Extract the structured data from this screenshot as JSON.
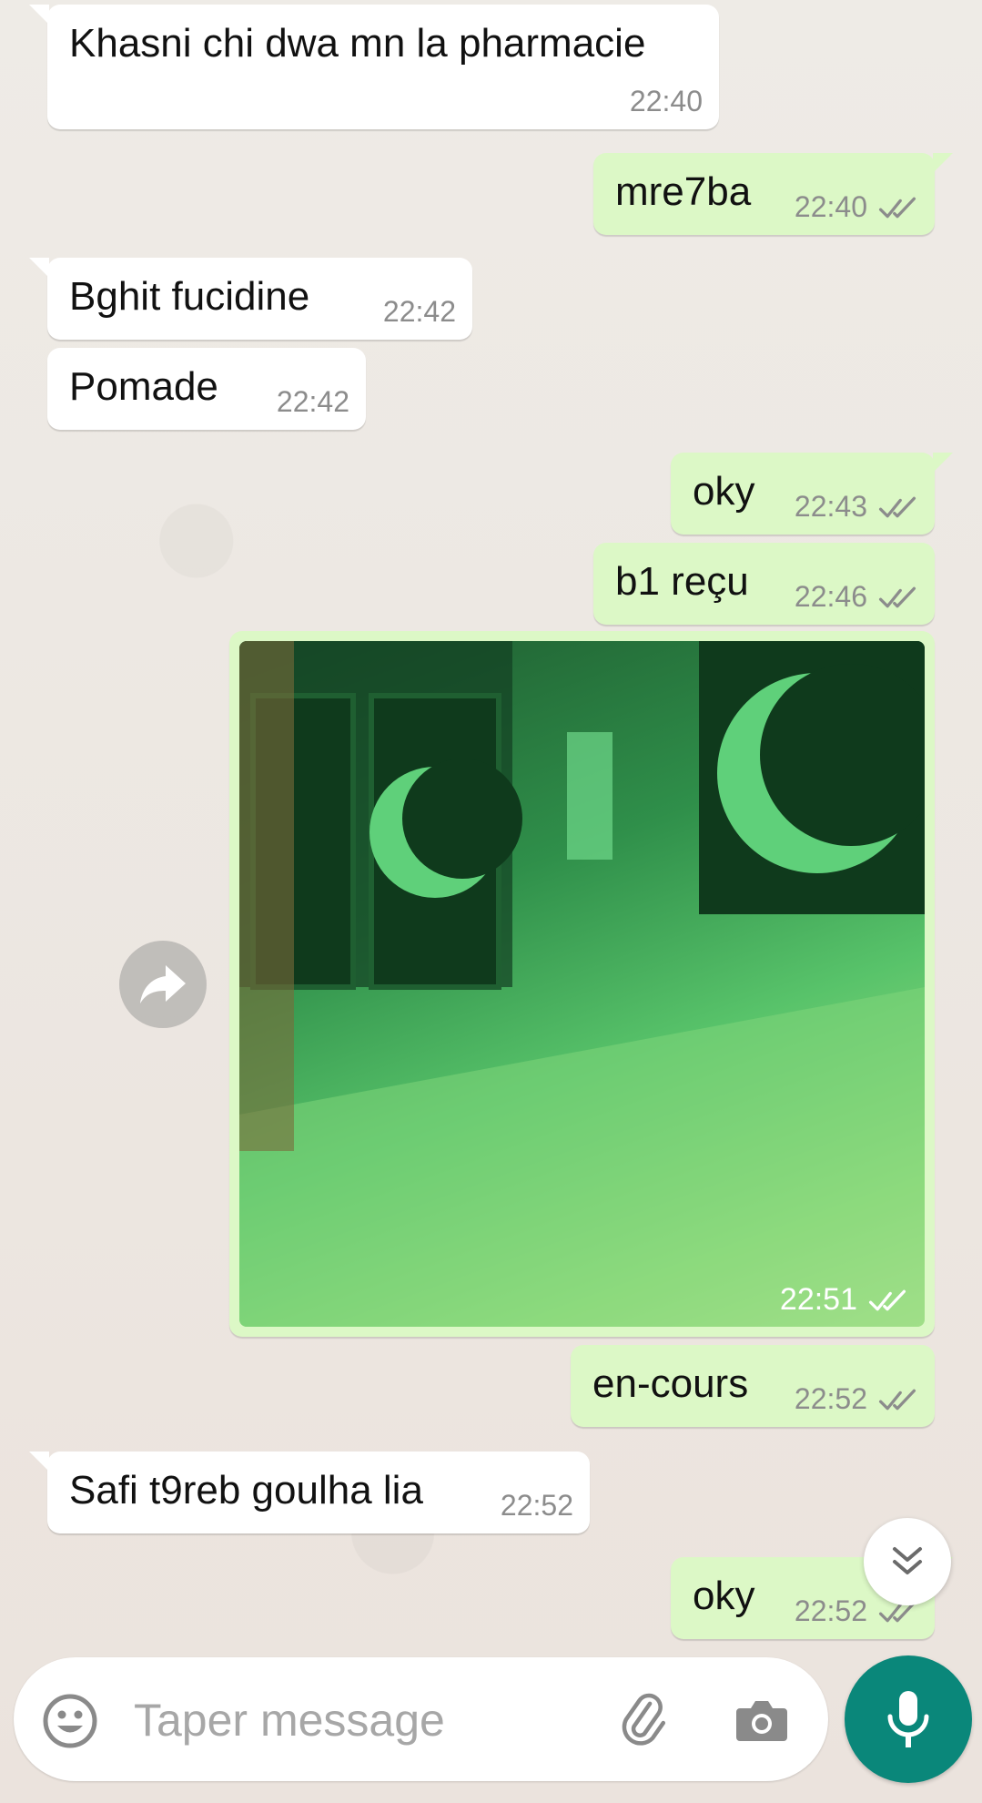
{
  "messages": [
    {
      "direction": "in",
      "text": "Khasni chi dwa mn la pharmacie",
      "time": "22:40"
    },
    {
      "direction": "out",
      "text": "mre7ba",
      "time": "22:40",
      "status": "read"
    },
    {
      "direction": "in",
      "text": "Bghit fucidine",
      "time": "22:42"
    },
    {
      "direction": "in",
      "text": "Pomade",
      "time": "22:42"
    },
    {
      "direction": "out",
      "text": "oky",
      "time": "22:43",
      "status": "read"
    },
    {
      "direction": "out",
      "text": "b1 reçu",
      "time": "22:46",
      "status": "read"
    },
    {
      "direction": "out",
      "type": "image",
      "time": "22:51",
      "status": "read"
    },
    {
      "direction": "out",
      "text": "en-cours",
      "time": "22:52",
      "status": "read"
    },
    {
      "direction": "in",
      "text": "Safi t9reb goulha lia",
      "time": "22:52"
    },
    {
      "direction": "out",
      "text": "oky",
      "time": "22:52",
      "status": "read"
    }
  ],
  "composer": {
    "placeholder": "Taper message",
    "icons": [
      "emoji-icon",
      "attach-icon",
      "camera-icon",
      "mic-icon"
    ]
  },
  "colors": {
    "outgoing": "#dcf8c6",
    "incoming": "#ffffff",
    "accent": "#0a877a",
    "read_tick": "#8c8c8c"
  }
}
